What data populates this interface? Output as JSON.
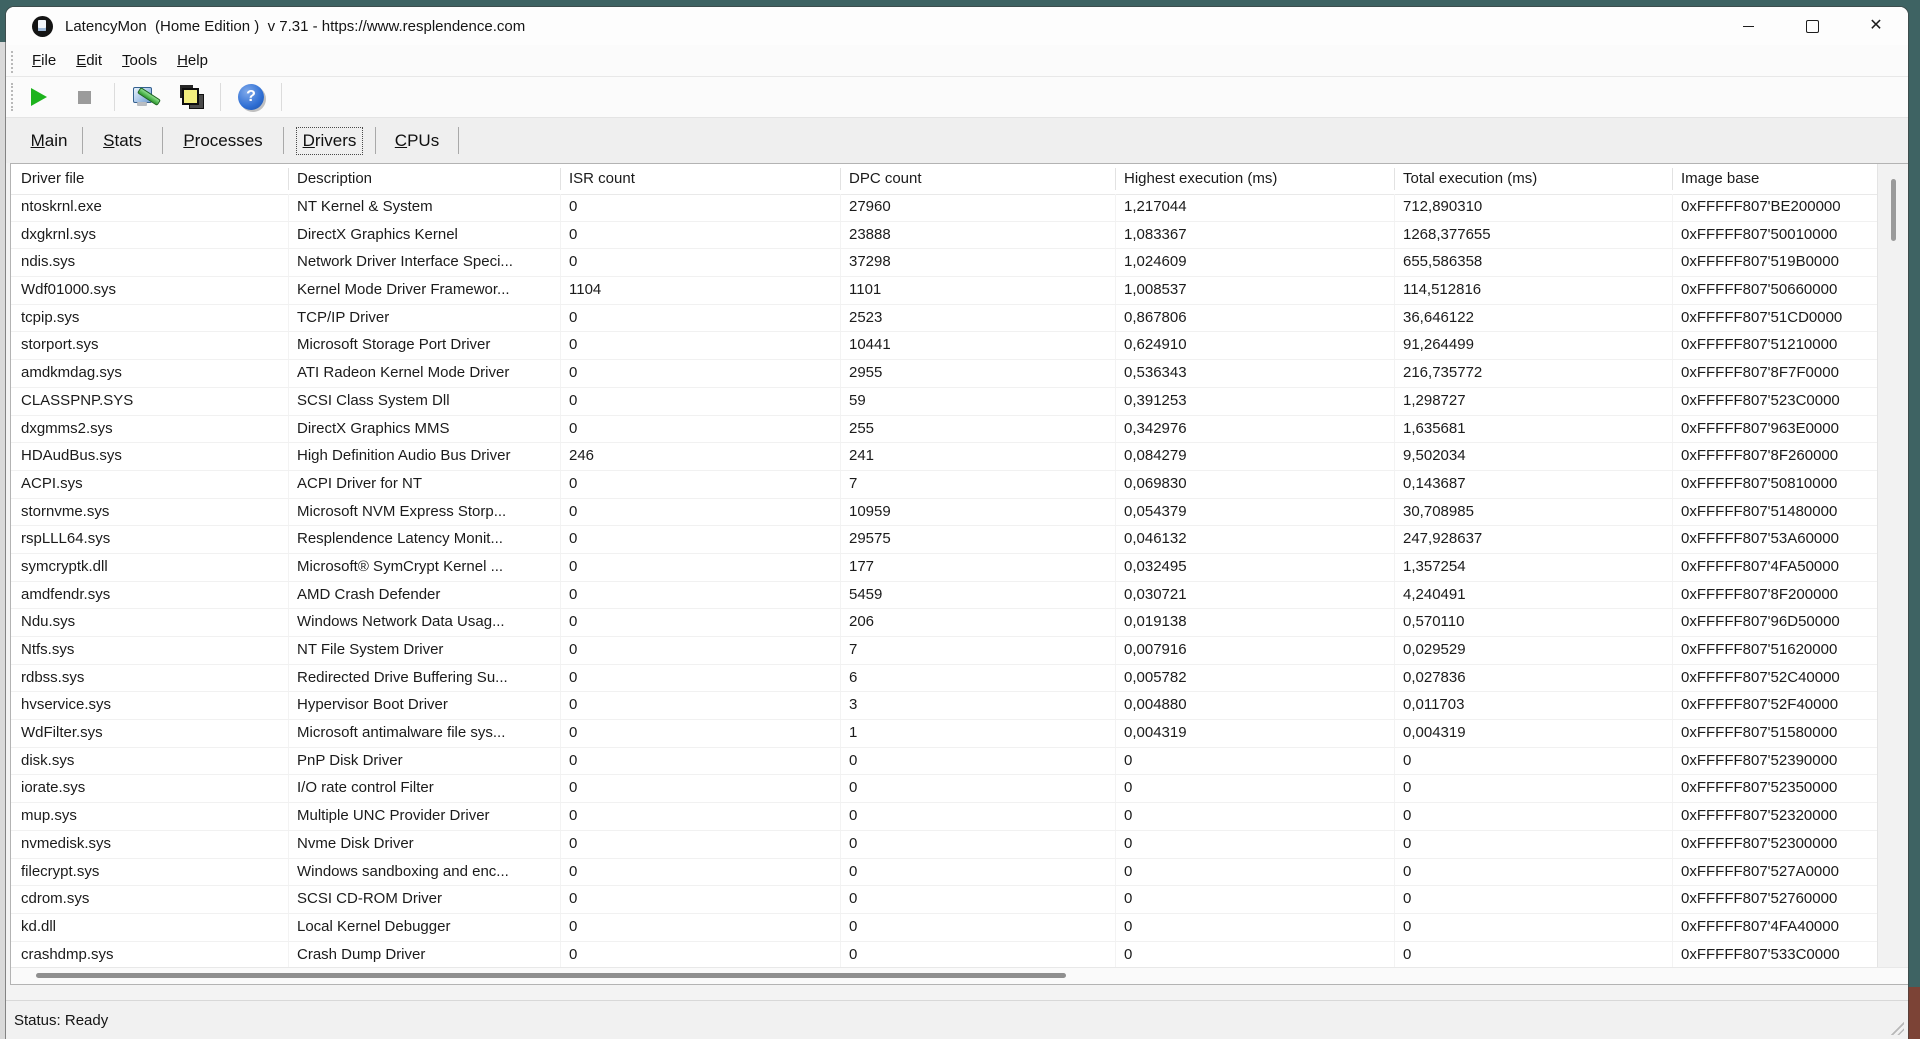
{
  "window": {
    "title": "LatencyMon  (Home Edition )  v 7.31 - https://www.resplendence.com",
    "controls": [
      "minimize",
      "maximize",
      "close"
    ]
  },
  "menu": {
    "items": [
      "File",
      "Edit",
      "Tools",
      "Help"
    ]
  },
  "toolbar": {
    "buttons": [
      {
        "name": "run",
        "icon": "play-icon"
      },
      {
        "name": "stop",
        "icon": "stop-icon"
      },
      {
        "name": "tools-options",
        "icon": "tools-icon"
      },
      {
        "name": "copy-report",
        "icon": "stacked-windows-icon"
      },
      {
        "name": "help",
        "icon": "help-icon"
      }
    ]
  },
  "tabs": [
    {
      "label": "Main",
      "selected": false
    },
    {
      "label": "Stats",
      "selected": false
    },
    {
      "label": "Processes",
      "selected": false
    },
    {
      "label": "Drivers",
      "selected": true
    },
    {
      "label": "CPUs",
      "selected": false
    }
  ],
  "table": {
    "columns": [
      "Driver file",
      "Description",
      "ISR count",
      "DPC count",
      "Highest execution (ms)",
      "Total execution (ms)",
      "Image base"
    ],
    "rows": [
      [
        "ntoskrnl.exe",
        "NT Kernel & System",
        "0",
        "27960",
        "1,217044",
        "712,890310",
        "0xFFFFF807'BE200000"
      ],
      [
        "dxgkrnl.sys",
        "DirectX Graphics Kernel",
        "0",
        "23888",
        "1,083367",
        "1268,377655",
        "0xFFFFF807'50010000"
      ],
      [
        "ndis.sys",
        "Network Driver Interface Speci...",
        "0",
        "37298",
        "1,024609",
        "655,586358",
        "0xFFFFF807'519B0000"
      ],
      [
        "Wdf01000.sys",
        "Kernel Mode Driver Framewor...",
        "1104",
        "1101",
        "1,008537",
        "114,512816",
        "0xFFFFF807'50660000"
      ],
      [
        "tcpip.sys",
        "TCP/IP Driver",
        "0",
        "2523",
        "0,867806",
        "36,646122",
        "0xFFFFF807'51CD0000"
      ],
      [
        "storport.sys",
        "Microsoft Storage Port Driver",
        "0",
        "10441",
        "0,624910",
        "91,264499",
        "0xFFFFF807'51210000"
      ],
      [
        "amdkmdag.sys",
        "ATI Radeon Kernel Mode Driver",
        "0",
        "2955",
        "0,536343",
        "216,735772",
        "0xFFFFF807'8F7F0000"
      ],
      [
        "CLASSPNP.SYS",
        "SCSI Class System Dll",
        "0",
        "59",
        "0,391253",
        "1,298727",
        "0xFFFFF807'523C0000"
      ],
      [
        "dxgmms2.sys",
        "DirectX Graphics MMS",
        "0",
        "255",
        "0,342976",
        "1,635681",
        "0xFFFFF807'963E0000"
      ],
      [
        "HDAudBus.sys",
        "High Definition Audio Bus Driver",
        "246",
        "241",
        "0,084279",
        "9,502034",
        "0xFFFFF807'8F260000"
      ],
      [
        "ACPI.sys",
        "ACPI Driver for NT",
        "0",
        "7",
        "0,069830",
        "0,143687",
        "0xFFFFF807'50810000"
      ],
      [
        "stornvme.sys",
        "Microsoft NVM Express Storp...",
        "0",
        "10959",
        "0,054379",
        "30,708985",
        "0xFFFFF807'51480000"
      ],
      [
        "rspLLL64.sys",
        "Resplendence Latency Monit...",
        "0",
        "29575",
        "0,046132",
        "247,928637",
        "0xFFFFF807'53A60000"
      ],
      [
        "symcryptk.dll",
        "Microsoft® SymCrypt Kernel ...",
        "0",
        "177",
        "0,032495",
        "1,357254",
        "0xFFFFF807'4FA50000"
      ],
      [
        "amdfendr.sys",
        "AMD Crash Defender",
        "0",
        "5459",
        "0,030721",
        "4,240491",
        "0xFFFFF807'8F200000"
      ],
      [
        "Ndu.sys",
        "Windows Network Data Usag...",
        "0",
        "206",
        "0,019138",
        "0,570110",
        "0xFFFFF807'96D50000"
      ],
      [
        "Ntfs.sys",
        "NT File System Driver",
        "0",
        "7",
        "0,007916",
        "0,029529",
        "0xFFFFF807'51620000"
      ],
      [
        "rdbss.sys",
        "Redirected Drive Buffering Su...",
        "0",
        "6",
        "0,005782",
        "0,027836",
        "0xFFFFF807'52C40000"
      ],
      [
        "hvservice.sys",
        "Hypervisor Boot Driver",
        "0",
        "3",
        "0,004880",
        "0,011703",
        "0xFFFFF807'52F40000"
      ],
      [
        "WdFilter.sys",
        "Microsoft antimalware file sys...",
        "0",
        "1",
        "0,004319",
        "0,004319",
        "0xFFFFF807'51580000"
      ],
      [
        "disk.sys",
        "PnP Disk Driver",
        "0",
        "0",
        "0",
        "0",
        "0xFFFFF807'52390000"
      ],
      [
        "iorate.sys",
        "I/O rate control Filter",
        "0",
        "0",
        "0",
        "0",
        "0xFFFFF807'52350000"
      ],
      [
        "mup.sys",
        "Multiple UNC Provider Driver",
        "0",
        "0",
        "0",
        "0",
        "0xFFFFF807'52320000"
      ],
      [
        "nvmedisk.sys",
        "Nvme Disk Driver",
        "0",
        "0",
        "0",
        "0",
        "0xFFFFF807'52300000"
      ],
      [
        "filecrypt.sys",
        "Windows sandboxing and enc...",
        "0",
        "0",
        "0",
        "0",
        "0xFFFFF807'527A0000"
      ],
      [
        "cdrom.sys",
        "SCSI CD-ROM Driver",
        "0",
        "0",
        "0",
        "0",
        "0xFFFFF807'52760000"
      ],
      [
        "kd.dll",
        "Local Kernel Debugger",
        "0",
        "0",
        "0",
        "0",
        "0xFFFFF807'4FA40000"
      ],
      [
        "crashdmp.sys",
        "Crash Dump Driver",
        "0",
        "0",
        "0",
        "0",
        "0xFFFFF807'533C0000"
      ]
    ]
  },
  "status": {
    "text": "Status: Ready"
  },
  "colors": {
    "desktop_teal": "#3e6363",
    "corner_red": "#7c4336",
    "play_green": "#1db31d",
    "stop_gray": "#9b9b9b",
    "help_blue": "#2f6fd4",
    "copy_yellow": "#f2ee7e"
  }
}
